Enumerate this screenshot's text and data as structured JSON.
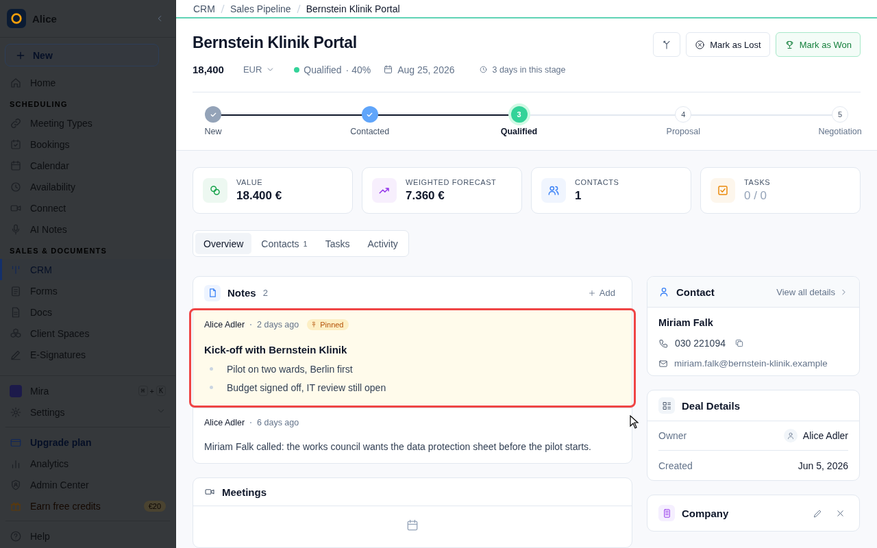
{
  "sidebar": {
    "workspace": "Alice",
    "new_button": "New",
    "nav": [
      {
        "kind": "item",
        "label": "Home",
        "selected": false
      },
      {
        "kind": "section",
        "label": "SCHEDULING"
      },
      {
        "kind": "item",
        "label": "Meeting Types",
        "selected": false
      },
      {
        "kind": "item",
        "label": "Bookings",
        "selected": false
      },
      {
        "kind": "item",
        "label": "Calendar",
        "selected": false
      },
      {
        "kind": "item",
        "label": "Availability",
        "selected": false
      },
      {
        "kind": "item",
        "label": "Connect",
        "selected": false
      },
      {
        "kind": "item",
        "label": "AI Notes",
        "selected": false
      },
      {
        "kind": "section",
        "label": "SALES & DOCUMENTS"
      },
      {
        "kind": "item",
        "label": "CRM",
        "selected": true
      },
      {
        "kind": "item",
        "label": "Forms",
        "selected": false
      },
      {
        "kind": "item",
        "label": "Docs",
        "selected": false
      },
      {
        "kind": "item",
        "label": "Client Spaces",
        "selected": false
      },
      {
        "kind": "item",
        "label": "E-Signatures",
        "selected": false
      }
    ],
    "assistant": {
      "label": "Mira",
      "keys": [
        "⌘",
        "+",
        "K"
      ]
    },
    "settings": {
      "label": "Settings",
      "expanded": false
    },
    "footer": [
      {
        "kind": "upgrade",
        "label": "Upgrade plan"
      },
      {
        "kind": "item",
        "label": "Analytics"
      },
      {
        "kind": "item",
        "label": "Admin Center"
      },
      {
        "kind": "credits",
        "label": "Earn free credits",
        "badge": "€20"
      }
    ],
    "help": "Help"
  },
  "breadcrumb": [
    "CRM",
    "Sales Pipeline",
    "Bernstein Klinik Portal"
  ],
  "deal": {
    "title": "Bernstein Klinik Portal",
    "amount": "18,400",
    "currency": "EUR",
    "status": "Qualified",
    "probability": "· 40%",
    "date": "Aug 25, 2026",
    "stage_time": "3 days in this stage",
    "buttons": [
      {
        "kind": "lost",
        "label": "Mark as Lost"
      },
      {
        "kind": "won",
        "label": "Mark as Won"
      }
    ]
  },
  "stages": [
    {
      "label": "New",
      "kind": "done",
      "color": "#94a3b8"
    },
    {
      "label": "Contacted",
      "kind": "done",
      "color": "#60a5fa"
    },
    {
      "label": "Qualified",
      "kind": "current",
      "number": "3",
      "color": "#34d399"
    },
    {
      "label": "Proposal",
      "kind": "upcoming",
      "number": "4"
    },
    {
      "label": "Negotiation",
      "kind": "upcoming",
      "number": "5"
    }
  ],
  "stats": [
    {
      "label": "VALUE",
      "value": "18.400 €",
      "muted": false,
      "color": "#16a34a"
    },
    {
      "label": "WEIGHTED FORECAST",
      "value": "7.360 €",
      "muted": false,
      "color": "#9333ea"
    },
    {
      "label": "CONTACTS",
      "value": "1",
      "muted": false,
      "color": "#3b82f6"
    },
    {
      "label": "TASKS",
      "value": "0 / 0",
      "muted": true,
      "color": "#ea8a0c"
    }
  ],
  "tabs": [
    {
      "label": "Overview",
      "selected": true
    },
    {
      "label": "Contacts",
      "count": "1",
      "selected": false
    },
    {
      "label": "Tasks",
      "selected": false
    },
    {
      "label": "Activity",
      "selected": false
    }
  ],
  "notes": {
    "title": "Notes",
    "count": "2",
    "add": "Add",
    "items": [
      {
        "author": "Alice Adler",
        "time": "2 days ago",
        "pinned": true,
        "pin_label": "Pinned",
        "highlighted": true,
        "title": "Kick-off with Bernstein Klinik",
        "bullets": [
          "Pilot on two wards, Berlin first",
          "Budget signed off, IT review still open"
        ]
      },
      {
        "author": "Alice Adler",
        "time": "6 days ago",
        "pinned": false,
        "highlighted": false,
        "body": "Miriam Falk called: the works council wants the data protection sheet before the pilot starts."
      }
    ]
  },
  "meetings": {
    "title": "Meetings"
  },
  "contact": {
    "title": "Contact",
    "link": "View all details",
    "name": "Miriam Falk",
    "phone": "030 221094",
    "email": "miriam.falk@bernstein-klinik.example"
  },
  "deal_details": {
    "title": "Deal Details",
    "rows": [
      {
        "kind": "person",
        "label": "Owner",
        "value": "Alice Adler"
      },
      {
        "kind": "text",
        "label": "Created",
        "value": "Jun 5, 2026"
      }
    ]
  },
  "company": {
    "title": "Company"
  }
}
